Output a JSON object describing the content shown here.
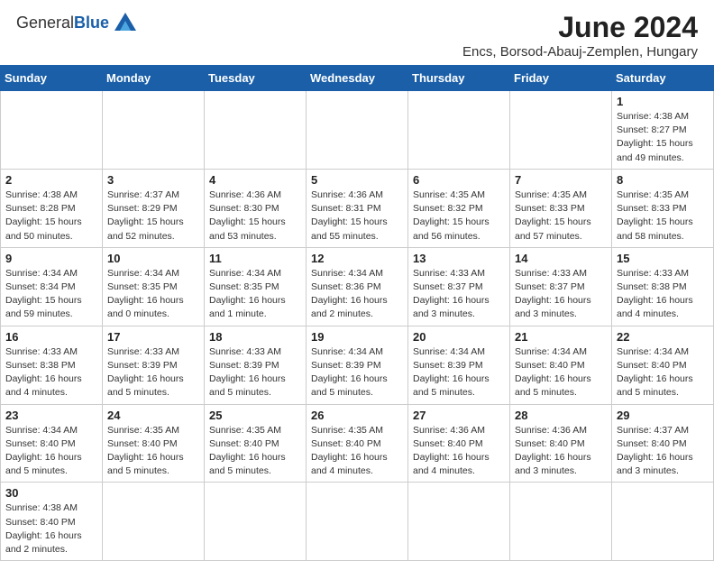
{
  "header": {
    "logo_general": "General",
    "logo_blue": "Blue",
    "month_title": "June 2024",
    "subtitle": "Encs, Borsod-Abauj-Zemplen, Hungary"
  },
  "weekdays": [
    "Sunday",
    "Monday",
    "Tuesday",
    "Wednesday",
    "Thursday",
    "Friday",
    "Saturday"
  ],
  "weeks": [
    [
      {
        "day": "",
        "info": ""
      },
      {
        "day": "",
        "info": ""
      },
      {
        "day": "",
        "info": ""
      },
      {
        "day": "",
        "info": ""
      },
      {
        "day": "",
        "info": ""
      },
      {
        "day": "",
        "info": ""
      },
      {
        "day": "1",
        "info": "Sunrise: 4:38 AM\nSunset: 8:27 PM\nDaylight: 15 hours and 49 minutes."
      }
    ],
    [
      {
        "day": "2",
        "info": "Sunrise: 4:38 AM\nSunset: 8:28 PM\nDaylight: 15 hours and 50 minutes."
      },
      {
        "day": "3",
        "info": "Sunrise: 4:37 AM\nSunset: 8:29 PM\nDaylight: 15 hours and 52 minutes."
      },
      {
        "day": "4",
        "info": "Sunrise: 4:36 AM\nSunset: 8:30 PM\nDaylight: 15 hours and 53 minutes."
      },
      {
        "day": "5",
        "info": "Sunrise: 4:36 AM\nSunset: 8:31 PM\nDaylight: 15 hours and 55 minutes."
      },
      {
        "day": "6",
        "info": "Sunrise: 4:35 AM\nSunset: 8:32 PM\nDaylight: 15 hours and 56 minutes."
      },
      {
        "day": "7",
        "info": "Sunrise: 4:35 AM\nSunset: 8:33 PM\nDaylight: 15 hours and 57 minutes."
      },
      {
        "day": "8",
        "info": "Sunrise: 4:35 AM\nSunset: 8:33 PM\nDaylight: 15 hours and 58 minutes."
      }
    ],
    [
      {
        "day": "9",
        "info": "Sunrise: 4:34 AM\nSunset: 8:34 PM\nDaylight: 15 hours and 59 minutes."
      },
      {
        "day": "10",
        "info": "Sunrise: 4:34 AM\nSunset: 8:35 PM\nDaylight: 16 hours and 0 minutes."
      },
      {
        "day": "11",
        "info": "Sunrise: 4:34 AM\nSunset: 8:35 PM\nDaylight: 16 hours and 1 minute."
      },
      {
        "day": "12",
        "info": "Sunrise: 4:34 AM\nSunset: 8:36 PM\nDaylight: 16 hours and 2 minutes."
      },
      {
        "day": "13",
        "info": "Sunrise: 4:33 AM\nSunset: 8:37 PM\nDaylight: 16 hours and 3 minutes."
      },
      {
        "day": "14",
        "info": "Sunrise: 4:33 AM\nSunset: 8:37 PM\nDaylight: 16 hours and 3 minutes."
      },
      {
        "day": "15",
        "info": "Sunrise: 4:33 AM\nSunset: 8:38 PM\nDaylight: 16 hours and 4 minutes."
      }
    ],
    [
      {
        "day": "16",
        "info": "Sunrise: 4:33 AM\nSunset: 8:38 PM\nDaylight: 16 hours and 4 minutes."
      },
      {
        "day": "17",
        "info": "Sunrise: 4:33 AM\nSunset: 8:39 PM\nDaylight: 16 hours and 5 minutes."
      },
      {
        "day": "18",
        "info": "Sunrise: 4:33 AM\nSunset: 8:39 PM\nDaylight: 16 hours and 5 minutes."
      },
      {
        "day": "19",
        "info": "Sunrise: 4:34 AM\nSunset: 8:39 PM\nDaylight: 16 hours and 5 minutes."
      },
      {
        "day": "20",
        "info": "Sunrise: 4:34 AM\nSunset: 8:39 PM\nDaylight: 16 hours and 5 minutes."
      },
      {
        "day": "21",
        "info": "Sunrise: 4:34 AM\nSunset: 8:40 PM\nDaylight: 16 hours and 5 minutes."
      },
      {
        "day": "22",
        "info": "Sunrise: 4:34 AM\nSunset: 8:40 PM\nDaylight: 16 hours and 5 minutes."
      }
    ],
    [
      {
        "day": "23",
        "info": "Sunrise: 4:34 AM\nSunset: 8:40 PM\nDaylight: 16 hours and 5 minutes."
      },
      {
        "day": "24",
        "info": "Sunrise: 4:35 AM\nSunset: 8:40 PM\nDaylight: 16 hours and 5 minutes."
      },
      {
        "day": "25",
        "info": "Sunrise: 4:35 AM\nSunset: 8:40 PM\nDaylight: 16 hours and 5 minutes."
      },
      {
        "day": "26",
        "info": "Sunrise: 4:35 AM\nSunset: 8:40 PM\nDaylight: 16 hours and 4 minutes."
      },
      {
        "day": "27",
        "info": "Sunrise: 4:36 AM\nSunset: 8:40 PM\nDaylight: 16 hours and 4 minutes."
      },
      {
        "day": "28",
        "info": "Sunrise: 4:36 AM\nSunset: 8:40 PM\nDaylight: 16 hours and 3 minutes."
      },
      {
        "day": "29",
        "info": "Sunrise: 4:37 AM\nSunset: 8:40 PM\nDaylight: 16 hours and 3 minutes."
      }
    ],
    [
      {
        "day": "30",
        "info": "Sunrise: 4:38 AM\nSunset: 8:40 PM\nDaylight: 16 hours and 2 minutes."
      },
      {
        "day": "",
        "info": ""
      },
      {
        "day": "",
        "info": ""
      },
      {
        "day": "",
        "info": ""
      },
      {
        "day": "",
        "info": ""
      },
      {
        "day": "",
        "info": ""
      },
      {
        "day": "",
        "info": ""
      }
    ]
  ]
}
